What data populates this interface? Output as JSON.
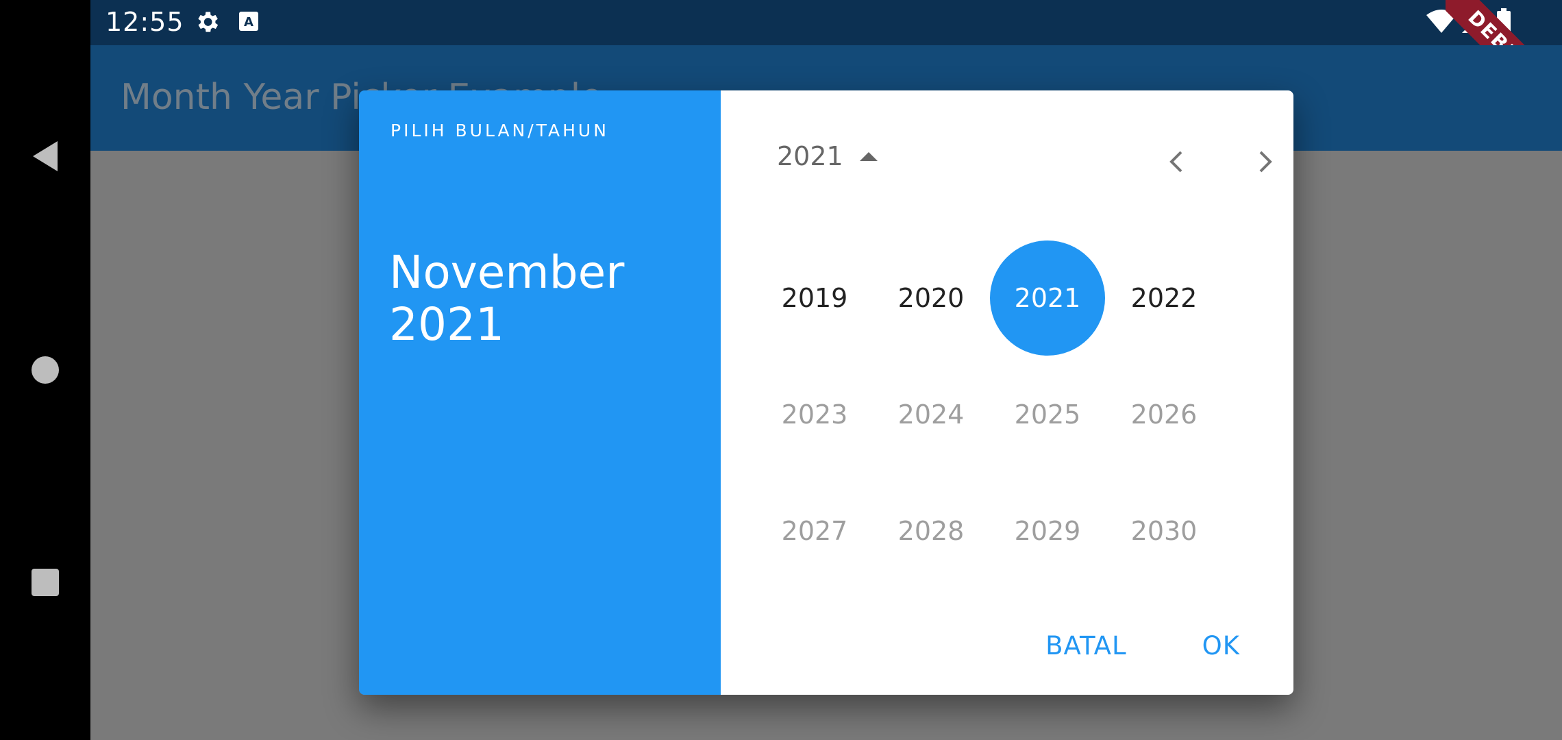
{
  "status_bar": {
    "time": "12:55"
  },
  "app_bar": {
    "title": "Month Year Picker Example"
  },
  "debug_banner": "DEBUG",
  "dialog": {
    "help_text": "PILIH BULAN/TAHUN",
    "selected_month": "November",
    "selected_year": "2021",
    "toggle_year": "2021",
    "years": [
      {
        "label": "2019",
        "state": "enabled"
      },
      {
        "label": "2020",
        "state": "enabled"
      },
      {
        "label": "2021",
        "state": "selected"
      },
      {
        "label": "2022",
        "state": "enabled"
      },
      {
        "label": "2023",
        "state": "disabled"
      },
      {
        "label": "2024",
        "state": "disabled"
      },
      {
        "label": "2025",
        "state": "disabled"
      },
      {
        "label": "2026",
        "state": "disabled"
      },
      {
        "label": "2027",
        "state": "disabled"
      },
      {
        "label": "2028",
        "state": "disabled"
      },
      {
        "label": "2029",
        "state": "disabled"
      },
      {
        "label": "2030",
        "state": "disabled"
      }
    ],
    "cancel_label": "BATAL",
    "ok_label": "OK"
  },
  "colors": {
    "primary": "#2196f3",
    "status_bar": "#0c3052",
    "app_bar": "#134a78",
    "scrim": "#7a7a7a",
    "debug": "#8e1b2b"
  },
  "icons": {
    "status": [
      "settings-icon",
      "text-input-icon",
      "wifi-icon",
      "signal-icon",
      "battery-icon"
    ],
    "nav": [
      "back-icon",
      "home-icon",
      "recents-icon"
    ],
    "dialog": [
      "caret-up-icon",
      "chevron-left-icon",
      "chevron-right-icon"
    ]
  }
}
